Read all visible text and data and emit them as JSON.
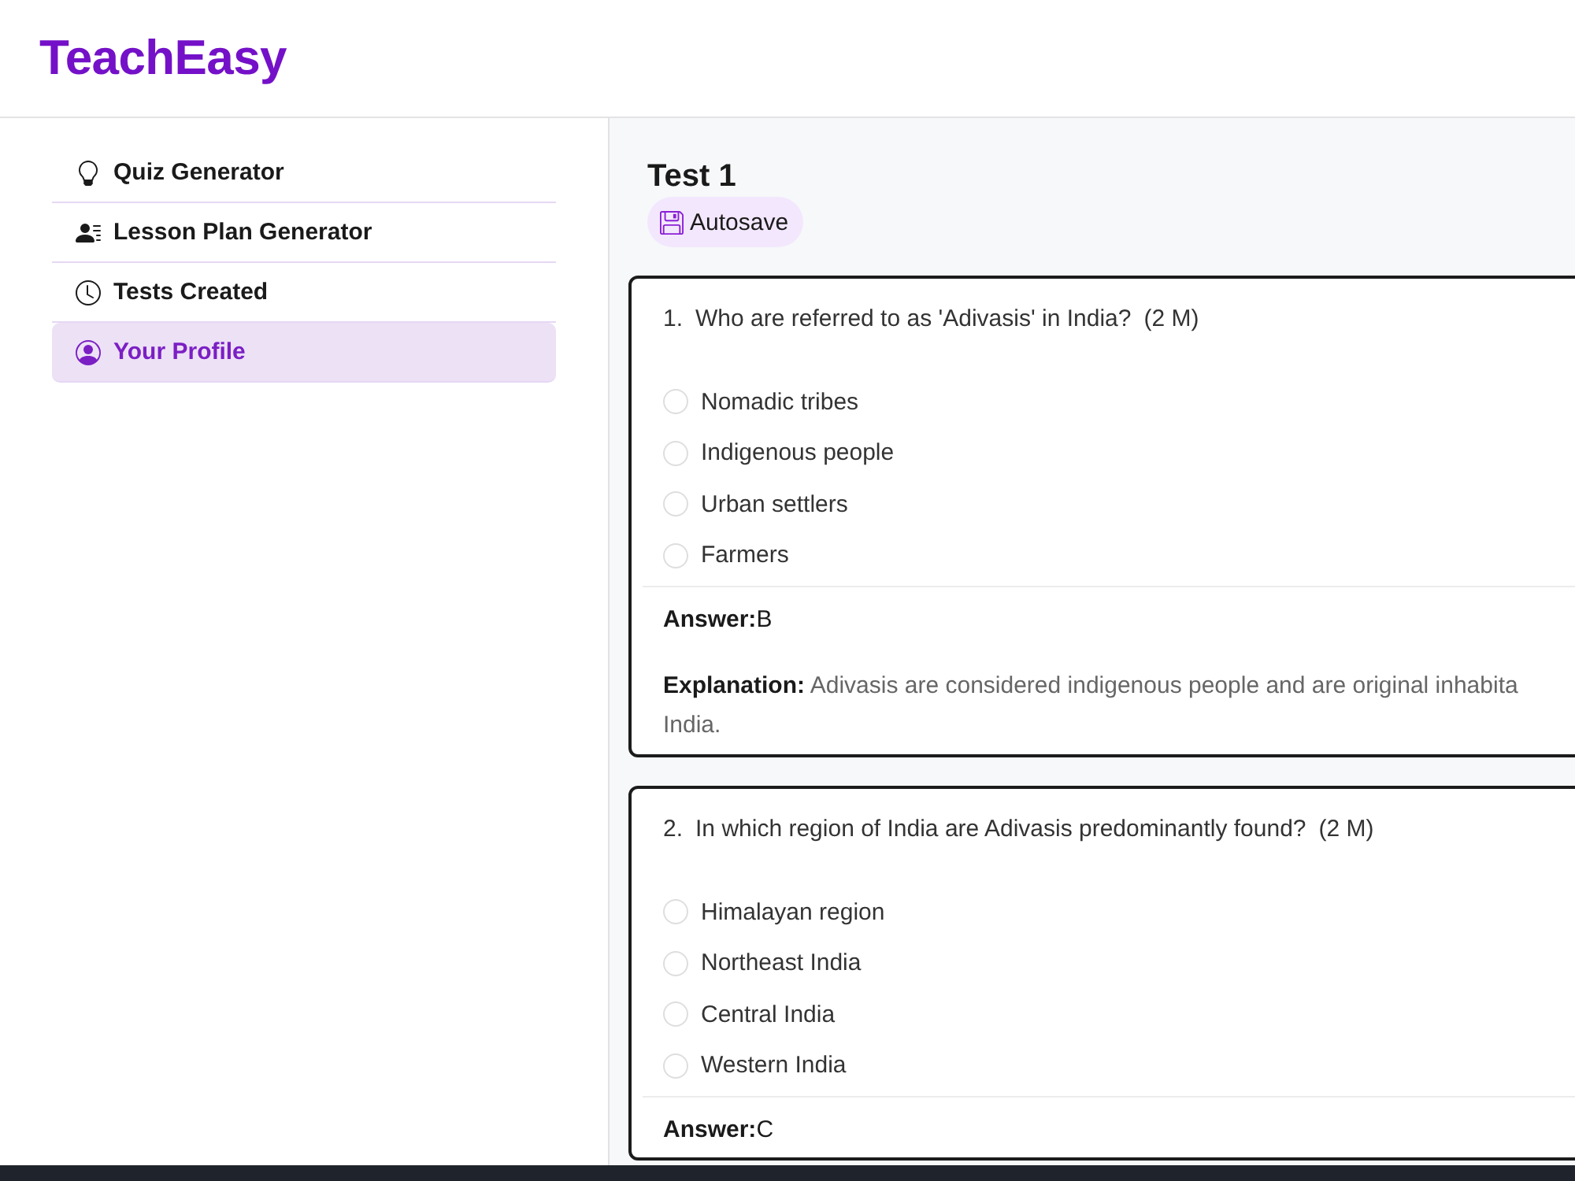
{
  "header": {
    "logo": "TeachEasy"
  },
  "sidebar": {
    "items": [
      {
        "label": "Quiz Generator",
        "selected": false
      },
      {
        "label": "Lesson Plan Generator",
        "selected": false
      },
      {
        "label": "Tests Created",
        "selected": false
      },
      {
        "label": "Your Profile",
        "selected": true
      }
    ]
  },
  "test": {
    "title": "Test 1",
    "autosave": "Autosave"
  },
  "questions": [
    {
      "number": "1.",
      "text": "Who are referred to as 'Adivasis' in India?",
      "marks": "(2 M)",
      "options": [
        {
          "label": "Nomadic tribes",
          "selected": false
        },
        {
          "label": "Indigenous people",
          "selected": false
        },
        {
          "label": "Urban settlers",
          "selected": false
        },
        {
          "label": "Farmers",
          "selected": false
        }
      ],
      "answer": "**Answer:**B",
      "explanation": [
        "**Explanation:** Adivasis are considered indigenous people and are original inhabita",
        "India."
      ]
    },
    {
      "number": "2.",
      "text": "In which region of India are Adivasis predominantly found?",
      "marks": "(2 M)",
      "options": [
        {
          "label": "Himalayan region",
          "selected": false
        },
        {
          "label": "Northeast India",
          "selected": false
        },
        {
          "label": "Central India",
          "selected": false
        },
        {
          "label": "Western India",
          "selected": false
        }
      ],
      "answer": "**Answer:**C"
    }
  ]
}
